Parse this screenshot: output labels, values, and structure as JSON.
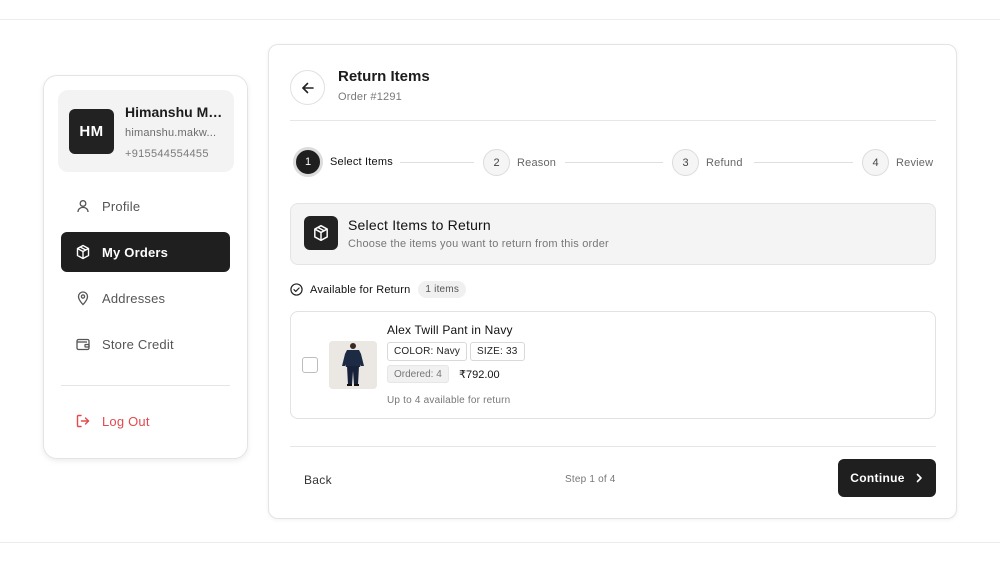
{
  "user": {
    "initials": "HM",
    "name": "Himanshu Ma...",
    "email": "himanshu.makw...",
    "phone": "+915544554455"
  },
  "nav": {
    "profile": "Profile",
    "orders": "My Orders",
    "addresses": "Addresses",
    "credit": "Store Credit",
    "logout": "Log Out"
  },
  "header": {
    "title": "Return Items",
    "order": "Order #1291"
  },
  "steps": [
    {
      "num": "1",
      "label": "Select Items"
    },
    {
      "num": "2",
      "label": "Reason"
    },
    {
      "num": "3",
      "label": "Refund"
    },
    {
      "num": "4",
      "label": "Review"
    }
  ],
  "section": {
    "title": "Select Items to Return",
    "subtitle": "Choose the items you want to return from this order"
  },
  "available": {
    "label": "Available for Return",
    "count": "1 items"
  },
  "item": {
    "name": "Alex Twill Pant in Navy",
    "color": "COLOR: Navy",
    "size": "SIZE: 33",
    "ordered": "Ordered: 4",
    "price": "₹792.00",
    "note": "Up to 4 available for return"
  },
  "footer": {
    "back": "Back",
    "step": "Step 1 of 4",
    "continue": "Continue"
  },
  "colors": {
    "primary": "#1f1f1f",
    "danger": "#e5484d"
  }
}
